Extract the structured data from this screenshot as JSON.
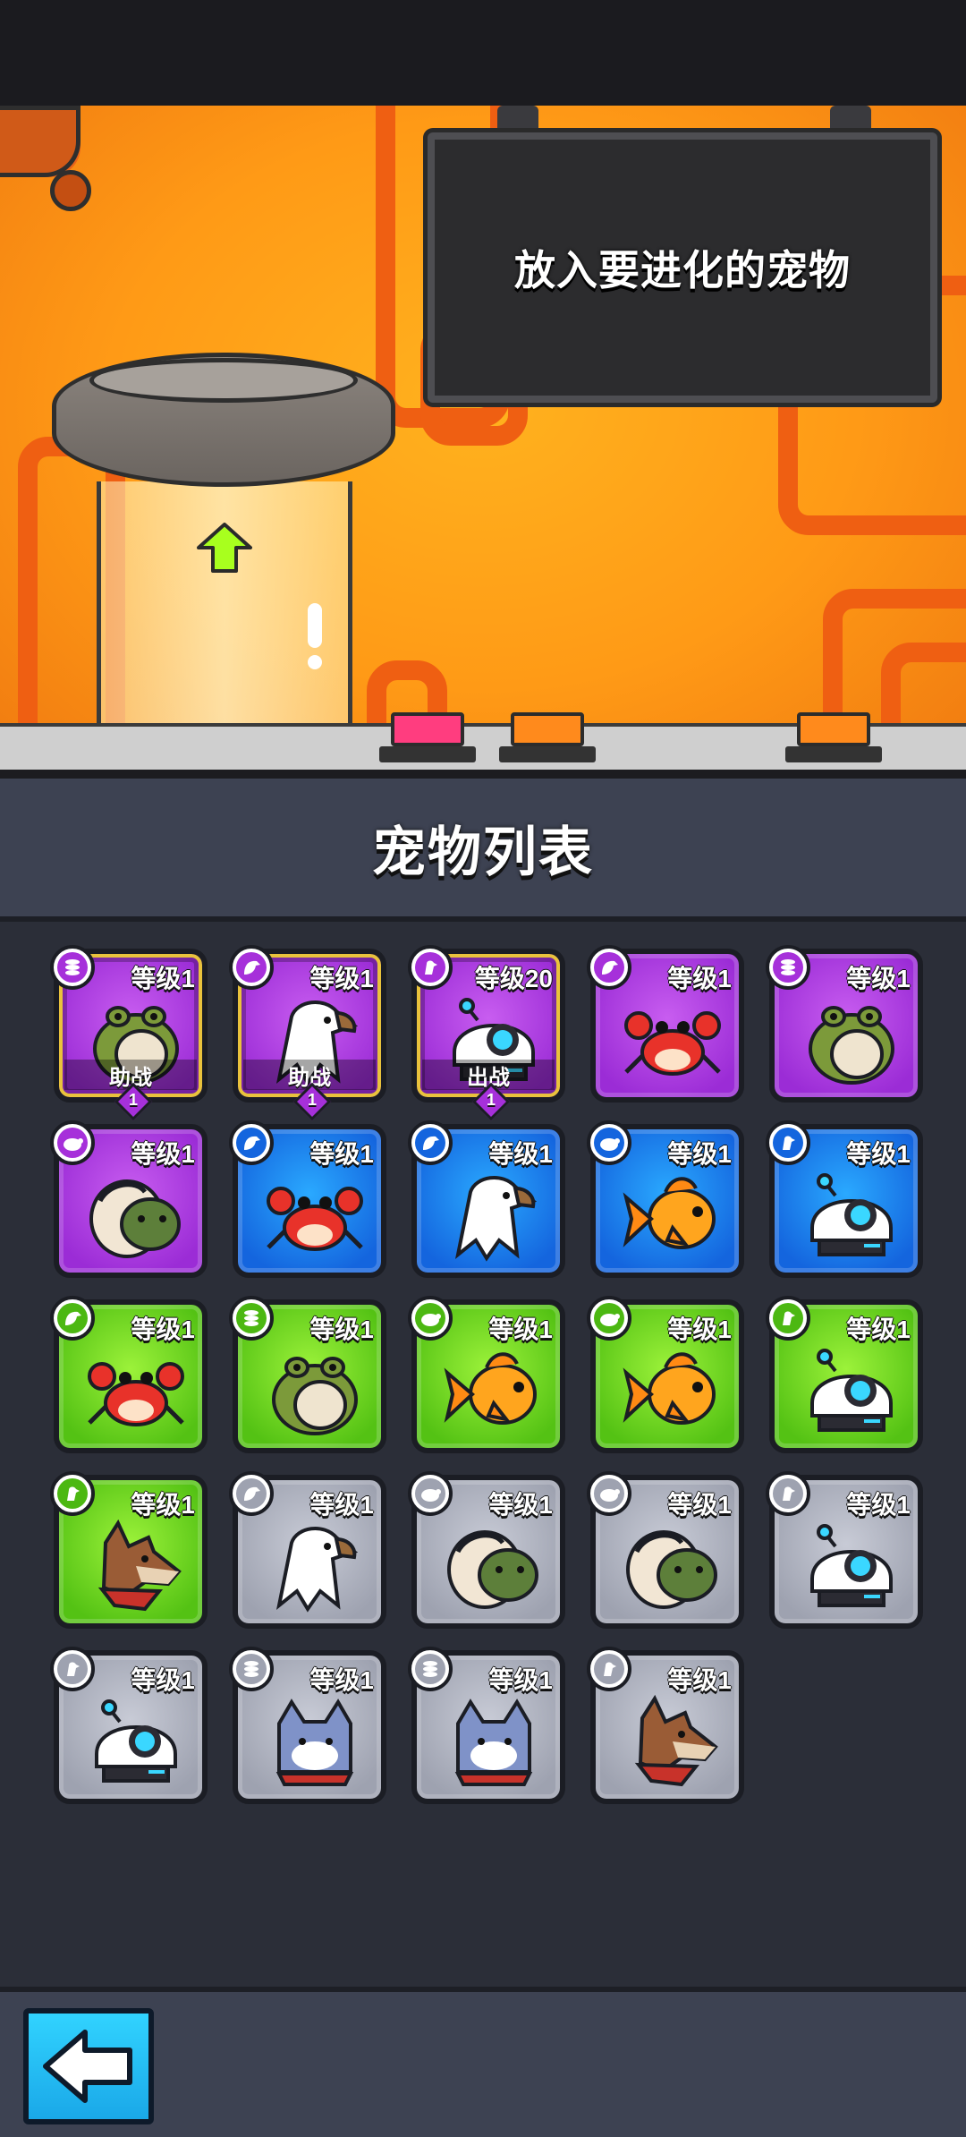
{
  "lab": {
    "prompt": "放入要进化的宠物",
    "colors": {
      "background": "#ff9a16",
      "pipe": "#ef5f12",
      "button_pink": "#ff3d7f",
      "button_orange": "#ff8a1c"
    }
  },
  "list": {
    "title": "宠物列表"
  },
  "back_button": {
    "icon": "arrow-left-icon"
  },
  "pets": [
    {
      "species": "frog",
      "level": "等级1",
      "rarity": "purple",
      "badge_icon": "coins-icon",
      "role": "助战",
      "team": "1"
    },
    {
      "species": "eagle",
      "level": "等级1",
      "rarity": "purple",
      "badge_icon": "eagle-icon",
      "role": "助战",
      "team": "1"
    },
    {
      "species": "robot",
      "level": "等级20",
      "rarity": "purple",
      "badge_icon": "bird-icon",
      "role": "出战",
      "team": "1"
    },
    {
      "species": "crab",
      "level": "等级1",
      "rarity": "purple",
      "badge_icon": "eagle-icon"
    },
    {
      "species": "frog",
      "level": "等级1",
      "rarity": "purple",
      "badge_icon": "coins-icon"
    },
    {
      "species": "turtle",
      "level": "等级1",
      "rarity": "purple",
      "badge_icon": "turtle-icon"
    },
    {
      "species": "crab",
      "level": "等级1",
      "rarity": "blue",
      "badge_icon": "eagle-icon"
    },
    {
      "species": "eagle",
      "level": "等级1",
      "rarity": "blue",
      "badge_icon": "eagle-icon"
    },
    {
      "species": "goldfish",
      "level": "等级1",
      "rarity": "blue",
      "badge_icon": "turtle-icon"
    },
    {
      "species": "robot",
      "level": "等级1",
      "rarity": "blue",
      "badge_icon": "bird-icon"
    },
    {
      "species": "crab",
      "level": "等级1",
      "rarity": "green",
      "badge_icon": "eagle-icon"
    },
    {
      "species": "frog",
      "level": "等级1",
      "rarity": "green",
      "badge_icon": "coins-icon"
    },
    {
      "species": "goldfish",
      "level": "等级1",
      "rarity": "green",
      "badge_icon": "turtle-icon"
    },
    {
      "species": "goldfish",
      "level": "等级1",
      "rarity": "green",
      "badge_icon": "turtle-icon"
    },
    {
      "species": "robot",
      "level": "等级1",
      "rarity": "green",
      "badge_icon": "bird-icon"
    },
    {
      "species": "dog",
      "level": "等级1",
      "rarity": "green",
      "badge_icon": "bird-icon"
    },
    {
      "species": "eagle",
      "level": "等级1",
      "rarity": "gray",
      "badge_icon": "eagle-icon"
    },
    {
      "species": "turtle",
      "level": "等级1",
      "rarity": "gray",
      "badge_icon": "turtle-icon"
    },
    {
      "species": "turtle",
      "level": "等级1",
      "rarity": "gray",
      "badge_icon": "turtle-icon"
    },
    {
      "species": "robot",
      "level": "等级1",
      "rarity": "gray",
      "badge_icon": "bird-icon"
    },
    {
      "species": "robot",
      "level": "等级1",
      "rarity": "gray",
      "badge_icon": "bird-icon"
    },
    {
      "species": "cat",
      "level": "等级1",
      "rarity": "gray",
      "badge_icon": "coins-icon"
    },
    {
      "species": "cat",
      "level": "等级1",
      "rarity": "gray",
      "badge_icon": "coins-icon"
    },
    {
      "species": "dog",
      "level": "等级1",
      "rarity": "gray",
      "badge_icon": "bird-icon"
    }
  ]
}
